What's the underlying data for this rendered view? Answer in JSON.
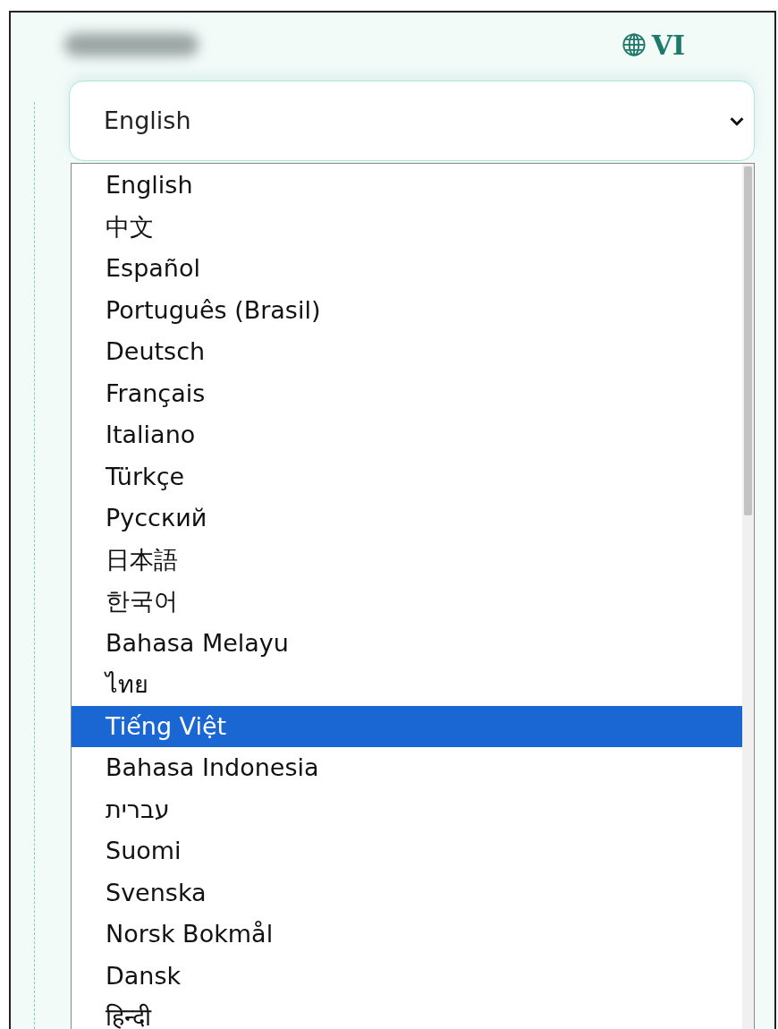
{
  "language_switch": {
    "code": "VI"
  },
  "language_select": {
    "value": "English",
    "expanded": true
  },
  "options": [
    {
      "label": "English",
      "selected": false
    },
    {
      "label": "中文",
      "selected": false
    },
    {
      "label": "Español",
      "selected": false
    },
    {
      "label": "Português (Brasil)",
      "selected": false
    },
    {
      "label": "Deutsch",
      "selected": false
    },
    {
      "label": "Français",
      "selected": false
    },
    {
      "label": "Italiano",
      "selected": false
    },
    {
      "label": "Türkçe",
      "selected": false
    },
    {
      "label": "Русский",
      "selected": false
    },
    {
      "label": "日本語",
      "selected": false
    },
    {
      "label": "한국어",
      "selected": false
    },
    {
      "label": "Bahasa Melayu",
      "selected": false
    },
    {
      "label": "ไทย",
      "selected": false
    },
    {
      "label": "Tiếng Việt",
      "selected": true
    },
    {
      "label": "Bahasa Indonesia",
      "selected": false
    },
    {
      "label": "עברית",
      "selected": false
    },
    {
      "label": "Suomi",
      "selected": false
    },
    {
      "label": "Svenska",
      "selected": false
    },
    {
      "label": "Norsk Bokmål",
      "selected": false
    },
    {
      "label": "Dansk",
      "selected": false
    },
    {
      "label": "हिन्दी",
      "selected": false
    }
  ]
}
